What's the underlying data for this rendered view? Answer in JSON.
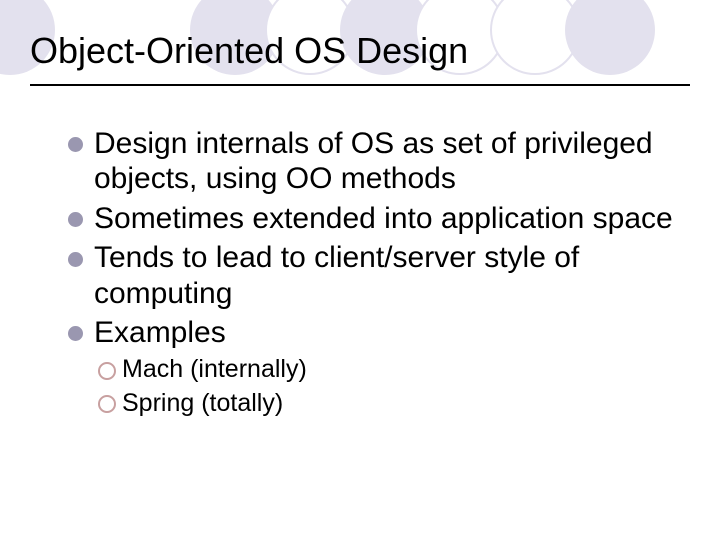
{
  "title": "Object-Oriented OS Design",
  "bullets": [
    "Design internals of OS as set of privileged objects, using OO methods",
    "Sometimes extended into application space",
    "Tends to lead to client/server style of computing",
    "Examples"
  ],
  "sub_bullets": [
    "Mach (internally)",
    "Spring (totally)"
  ]
}
